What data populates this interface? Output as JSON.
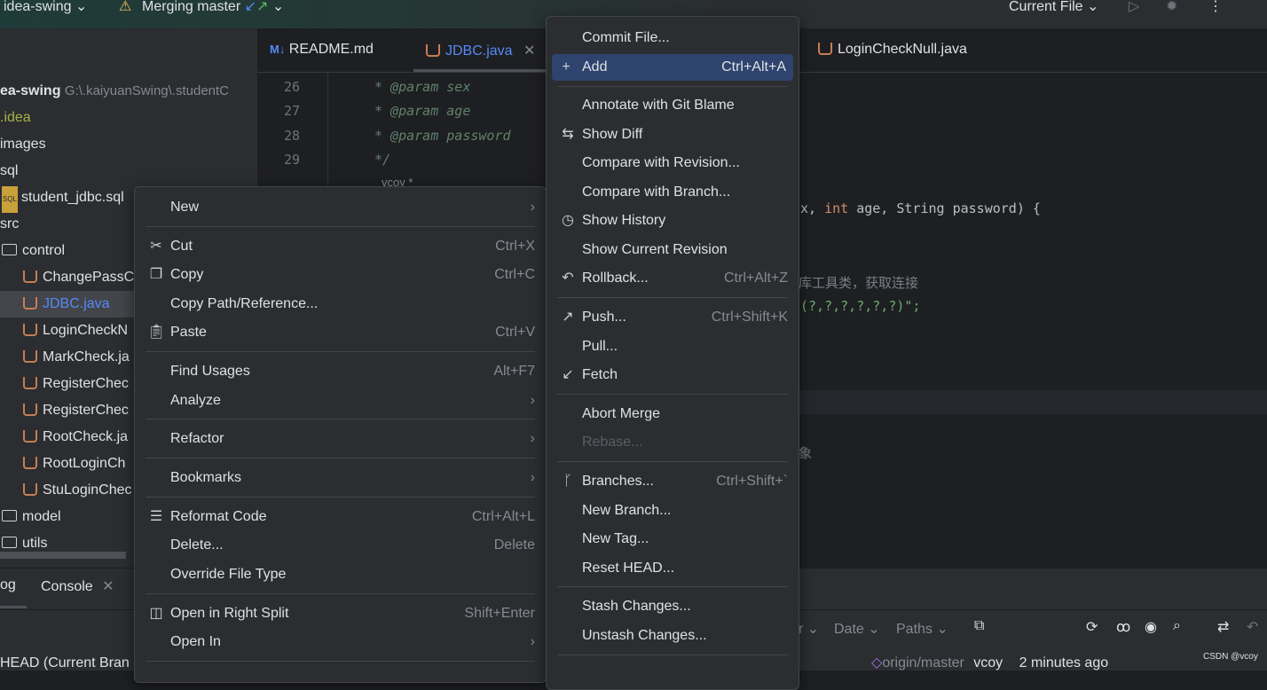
{
  "titlebar": {
    "project": "idea-swing",
    "merge": "Merging master",
    "run_config": "Current File"
  },
  "project_tree": {
    "root_name": "ea-swing",
    "root_path": "G:\\.kaiyuanSwing\\.studentC",
    "items": [
      ".idea",
      "images",
      "sql",
      "student_jdbc.sql",
      "src",
      "control",
      "ChangePassC",
      "JDBC.java",
      "LoginCheckN",
      "MarkCheck.ja",
      "RegisterChec",
      "RegisterChec",
      "RootCheck.ja",
      "RootLoginCh",
      "StuLoginChec",
      "model",
      "utils"
    ]
  },
  "editor": {
    "tabs": [
      {
        "label": "README.md",
        "icon": "markdown-icon"
      },
      {
        "label": "JDBC.java",
        "icon": "java-icon",
        "active": true
      },
      {
        "label": "LoginCheckNull.java",
        "icon": "java-icon"
      }
    ],
    "line_numbers": [
      "26",
      "27",
      "28",
      "29"
    ],
    "lines": [
      "* @param sex",
      "* @param age",
      "* @param password",
      "*/"
    ],
    "author_hint": "vcoy *",
    "sig_tail_1": "x, ",
    "sig_kw": "int",
    "sig_tail_2": " age, String password) {",
    "comment_cn": "库工具类，获取连接",
    "sql_tail": "(?,?,?,?,?,?)\";",
    "cn_2": "象"
  },
  "context_menu": {
    "items": [
      {
        "label": "New",
        "submenu": true
      },
      {
        "label": "Cut",
        "shortcut": "Ctrl+X",
        "icon": "scissors-icon"
      },
      {
        "label": "Copy",
        "shortcut": "Ctrl+C",
        "icon": "copy-icon"
      },
      {
        "label": "Copy Path/Reference..."
      },
      {
        "label": "Paste",
        "shortcut": "Ctrl+V",
        "icon": "paste-icon"
      },
      {
        "label": "Find Usages",
        "shortcut": "Alt+F7"
      },
      {
        "label": "Analyze",
        "submenu": true
      },
      {
        "label": "Refactor",
        "submenu": true
      },
      {
        "label": "Bookmarks",
        "submenu": true
      },
      {
        "label": "Reformat Code",
        "shortcut": "Ctrl+Alt+L",
        "icon": "reformat-icon"
      },
      {
        "label": "Delete...",
        "shortcut": "Delete"
      },
      {
        "label": "Override File Type"
      },
      {
        "label": "Open in Right Split",
        "shortcut": "Shift+Enter",
        "icon": "split-icon"
      },
      {
        "label": "Open In",
        "submenu": true
      }
    ]
  },
  "git_menu": {
    "items": [
      {
        "label": "Commit File..."
      },
      {
        "label": "Add",
        "shortcut": "Ctrl+Alt+A",
        "icon": "plus-icon",
        "highlighted": true
      },
      {
        "label": "Annotate with Git Blame"
      },
      {
        "label": "Show Diff",
        "icon": "diff-icon"
      },
      {
        "label": "Compare with Revision..."
      },
      {
        "label": "Compare with Branch..."
      },
      {
        "label": "Show History",
        "icon": "clock-icon"
      },
      {
        "label": "Show Current Revision"
      },
      {
        "label": "Rollback...",
        "shortcut": "Ctrl+Alt+Z",
        "icon": "rollback-icon"
      },
      {
        "label": "Push...",
        "shortcut": "Ctrl+Shift+K",
        "icon": "push-icon"
      },
      {
        "label": "Pull..."
      },
      {
        "label": "Fetch",
        "icon": "fetch-icon"
      },
      {
        "label": "Abort Merge"
      },
      {
        "label": "Rebase...",
        "disabled": true
      },
      {
        "label": "Branches...",
        "shortcut": "Ctrl+Shift+`",
        "icon": "branch-icon"
      },
      {
        "label": "New Branch..."
      },
      {
        "label": "New Tag..."
      },
      {
        "label": "Reset HEAD..."
      },
      {
        "label": "Stash Changes..."
      },
      {
        "label": "Unstash Changes..."
      }
    ]
  },
  "bottom": {
    "tab_log": "og",
    "tab_console": "Console",
    "head": "HEAD (Current Bran",
    "filters": [
      "r",
      "Date",
      "Paths"
    ],
    "ref": "origin/master",
    "author": "vcoy",
    "time": "2 minutes ago",
    "watermark": "CSDN @vcoy"
  },
  "colors": {
    "accent": "#2e436e",
    "java": "#c77d55",
    "comment": "#5f826b",
    "keyword": "#cf8e6d",
    "string": "#6aab73"
  }
}
